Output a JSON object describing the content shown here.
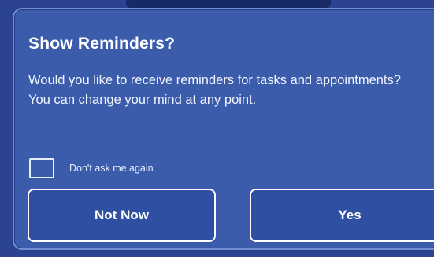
{
  "dialog": {
    "title": "Show Reminders?",
    "message": "Would you like to receive reminders for tasks and appointments? You can change your mind at any point.",
    "checkbox": {
      "label": "Don't ask me again",
      "checked": false
    },
    "buttons": {
      "not_now": "Not Now",
      "yes": "Yes"
    }
  },
  "colors": {
    "dialog_background": "#3a5caa",
    "dialog_border": "#6f8fd0",
    "backdrop": "#2c4392",
    "text": "#ffffff"
  }
}
